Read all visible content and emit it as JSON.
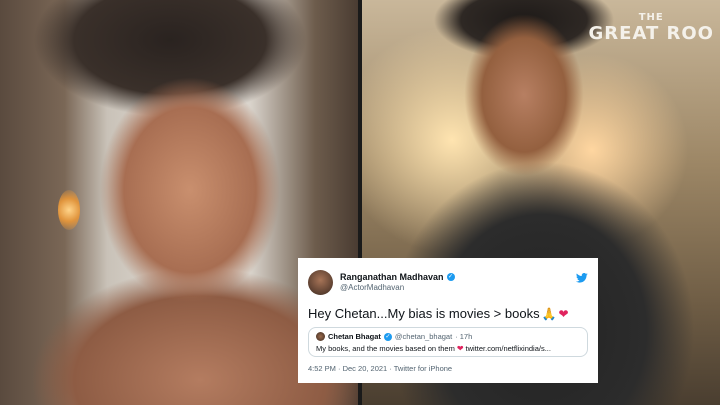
{
  "sign": {
    "line1": "THE",
    "line2": "GREAT ROO"
  },
  "tweet": {
    "author_name": "Ranganathan Madhavan",
    "author_handle": "@ActorMadhavan",
    "text": "Hey Chetan...My bias is movies > books",
    "pray_emoji": "🙏",
    "heart_emoji": "❤",
    "quote": {
      "author_name": "Chetan Bhagat",
      "author_handle": "@chetan_bhagat",
      "time": "· 17h",
      "text_before": "My books, and the movies based on them",
      "heart_emoji": "❤",
      "link": "twitter.com/netflixindia/s..."
    },
    "timestamp": "4:52 PM · Dec 20, 2021 · Twitter for iPhone"
  },
  "colors": {
    "verified": "#1d9bf0",
    "twitter_blue": "#1d9bf0",
    "heart": "#e0245e",
    "secondary_text": "#536471"
  }
}
